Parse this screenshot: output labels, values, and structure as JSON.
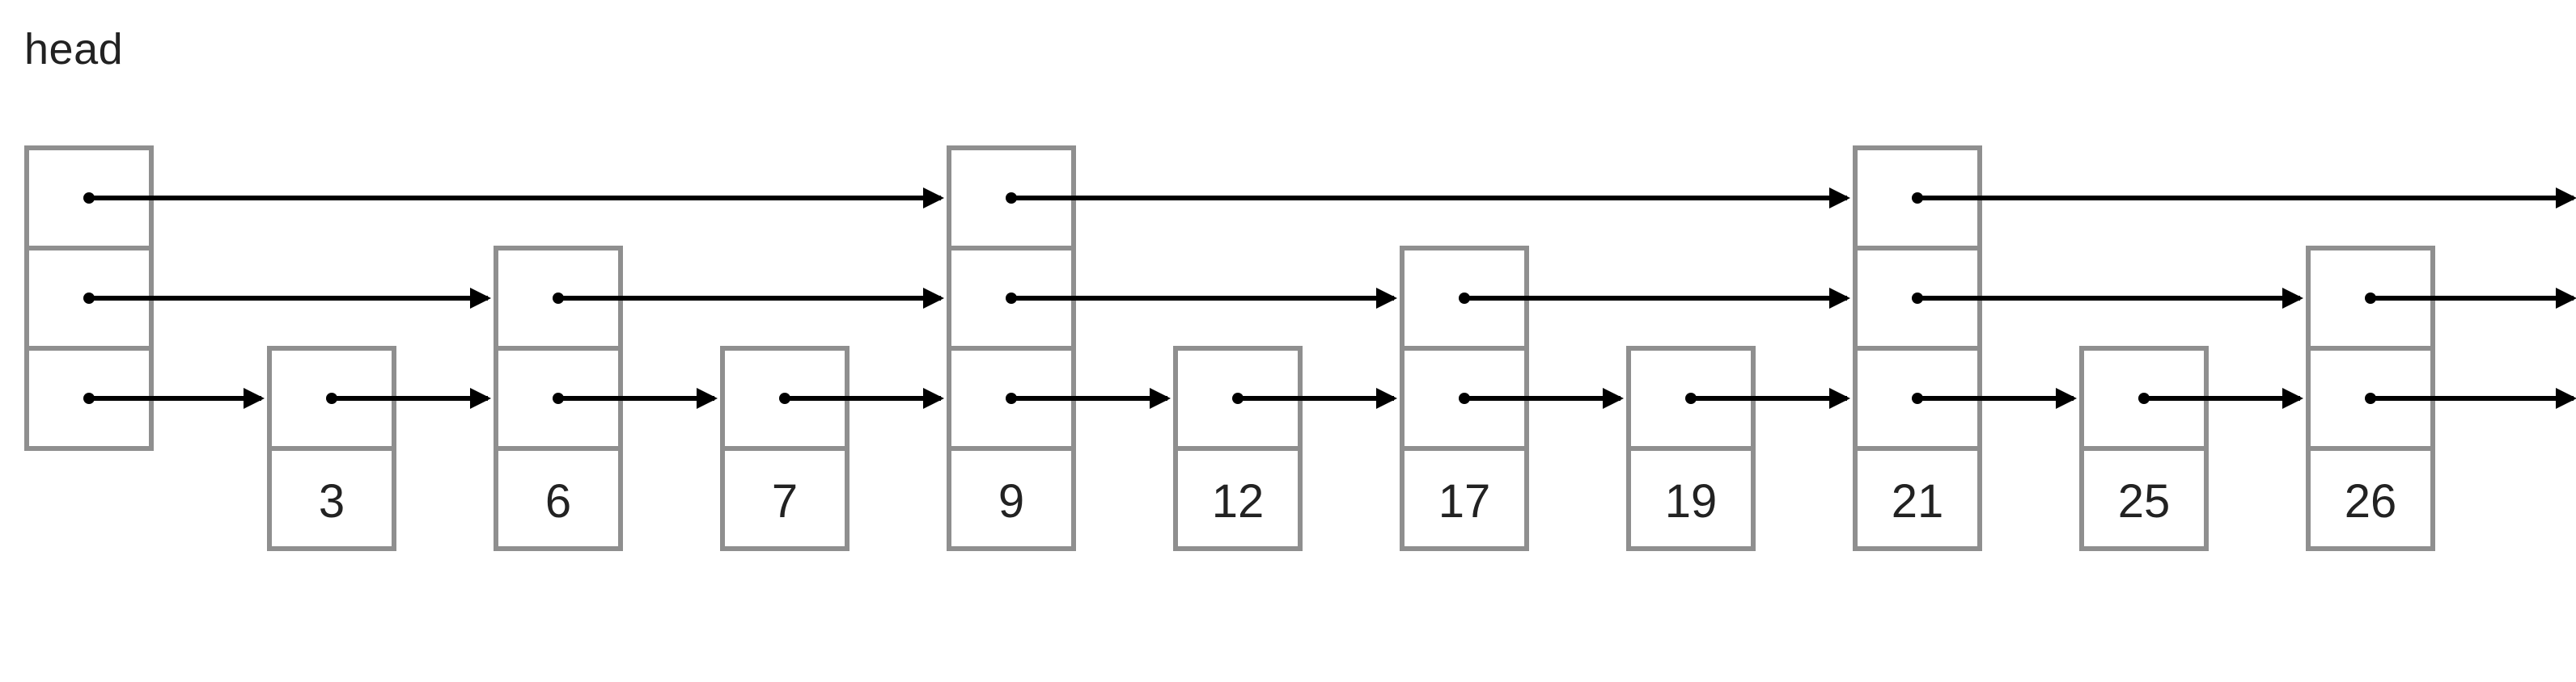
{
  "chart_data": {
    "type": "diagram",
    "title": "head",
    "structure": "skip-list",
    "null_label": "null",
    "levels": 3,
    "nodes": [
      {
        "id": "head",
        "value": null,
        "levels": 3
      },
      {
        "id": "n3",
        "value": 3,
        "levels": 1
      },
      {
        "id": "n6",
        "value": 6,
        "levels": 2
      },
      {
        "id": "n7",
        "value": 7,
        "levels": 1
      },
      {
        "id": "n9",
        "value": 9,
        "levels": 3
      },
      {
        "id": "n12",
        "value": 12,
        "levels": 1
      },
      {
        "id": "n17",
        "value": 17,
        "levels": 2
      },
      {
        "id": "n19",
        "value": 19,
        "levels": 1
      },
      {
        "id": "n21",
        "value": 21,
        "levels": 3
      },
      {
        "id": "n25",
        "value": 25,
        "levels": 1
      },
      {
        "id": "n26",
        "value": 26,
        "levels": 2
      }
    ],
    "level_links": {
      "2": [
        "head",
        "n9",
        "n21",
        "null"
      ],
      "1": [
        "head",
        "n6",
        "n9",
        "n17",
        "n21",
        "n26",
        "null"
      ],
      "0": [
        "head",
        "n3",
        "n6",
        "n7",
        "n9",
        "n12",
        "n17",
        "n19",
        "n21",
        "n25",
        "n26",
        "null"
      ]
    }
  }
}
